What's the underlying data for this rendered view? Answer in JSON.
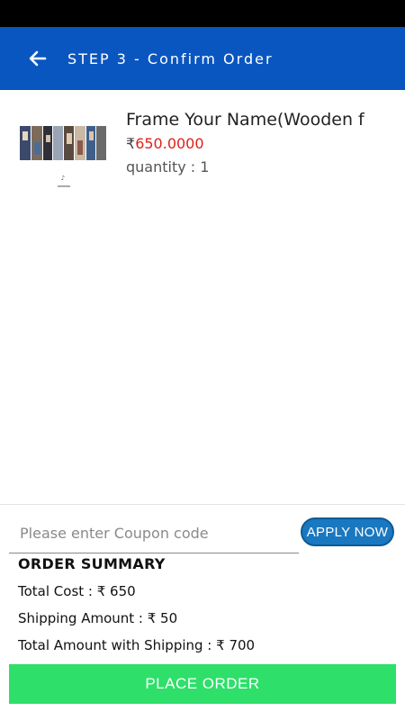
{
  "header": {
    "title": "STEP 3 - Confirm Order",
    "back_icon": "arrow-left-icon"
  },
  "product": {
    "name": "Frame Your Name(Wooden f",
    "currency": "₹",
    "price": "650.0000",
    "quantity": "quantity : 1",
    "thumbnail_text": "GIFTERIA"
  },
  "coupon": {
    "placeholder": "Please enter Coupon code",
    "value": "",
    "apply_label": "APPLY NOW"
  },
  "summary": {
    "title": "ORDER SUMMARY",
    "total_cost": "Total Cost : ₹ 650",
    "shipping": "Shipping Amount : ₹ 50",
    "total_with_shipping": "Total Amount with Shipping : ₹ 700"
  },
  "actions": {
    "place_order": "PLACE ORDER"
  },
  "colors": {
    "app_bar": "#0a56c0",
    "price": "#e0201a",
    "apply_button": "#1a78c0",
    "place_order_button": "#2edf6a"
  }
}
